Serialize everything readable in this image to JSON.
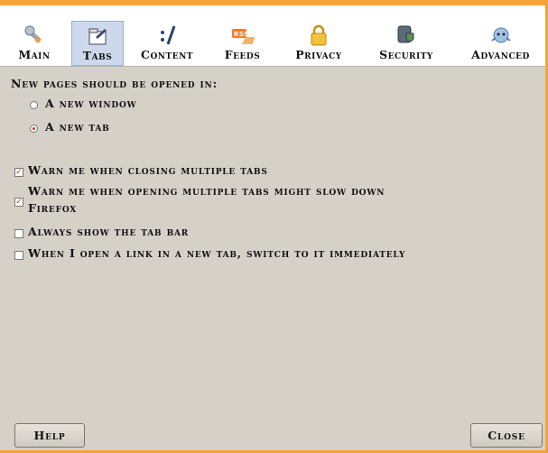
{
  "toolbar": {
    "items": [
      {
        "label": "Main",
        "icon": "wrench-icon"
      },
      {
        "label": "Tabs",
        "icon": "tabs-icon",
        "selected": true
      },
      {
        "label": "Content",
        "icon": "content-icon"
      },
      {
        "label": "Feeds",
        "icon": "rss-feed-icon"
      },
      {
        "label": "Privacy",
        "icon": "lock-icon"
      },
      {
        "label": "Security",
        "icon": "security-icon"
      },
      {
        "label": "Advanced",
        "icon": "advanced-icon"
      }
    ]
  },
  "tabs_pane": {
    "open_heading": "New pages should be opened in:",
    "option_new_window": "A new window",
    "option_new_tab": "A new tab",
    "warn_closing": "Warn me when closing multiple tabs",
    "warn_opening_line1": "Warn me when opening multiple tabs might slow down",
    "warn_opening_line2": "Firefox",
    "always_show_tab_bar": "Always show the tab bar",
    "switch_to_new_tab": "When I open a link in a new tab, switch to it immediately",
    "selected_open_option": "A new tab",
    "checkbox_states": {
      "warn_closing": true,
      "warn_opening": true,
      "always_show_tab_bar": false,
      "switch_to_new_tab": false
    }
  },
  "buttons": {
    "help": "Help",
    "close": "Close"
  },
  "colors": {
    "accent_orange": "#f6a235",
    "panel_bg": "#d5d0c8",
    "selection_bg": "#cdd9ea",
    "check_red": "#c0392b"
  }
}
